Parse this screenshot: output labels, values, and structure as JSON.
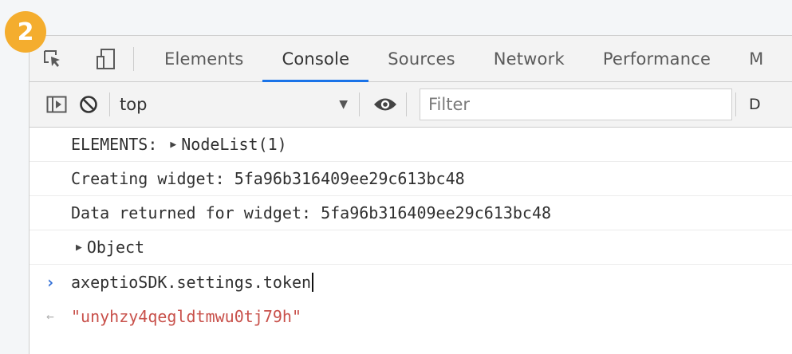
{
  "step": {
    "number": "2"
  },
  "devtools": {
    "tabs": [
      {
        "label": "Elements",
        "active": false
      },
      {
        "label": "Console",
        "active": true
      },
      {
        "label": "Sources",
        "active": false
      },
      {
        "label": "Network",
        "active": false
      },
      {
        "label": "Performance",
        "active": false
      },
      {
        "label": "M",
        "active": false
      }
    ],
    "toolbar": {
      "context": "top",
      "filter_placeholder": "Filter",
      "truncated_label": "D"
    },
    "console": {
      "lines": [
        {
          "prefix": "ELEMENTS: ",
          "expandable_label": "NodeList(1)"
        },
        {
          "text": "Creating widget: 5fa96b316409ee29c613bc48"
        },
        {
          "text": "Data returned for widget: 5fa96b316409ee29c613bc48"
        },
        {
          "expandable_label": "Object"
        }
      ],
      "input": {
        "text": "axeptioSDK.settings.token"
      },
      "result": {
        "text": "\"unyhzy4qegldtmwu0tj79h\""
      }
    }
  },
  "colors": {
    "badge": "#f4ad2e",
    "active_tab_underline": "#1a73e8",
    "prompt_arrow": "#2f6dd6",
    "result_string": "#c8504a"
  },
  "icons": [
    "inspect-element-icon",
    "device-toolbar-icon",
    "sidebar-toggle-icon",
    "clear-console-icon",
    "dropdown-arrow-icon",
    "eye-icon",
    "prompt-arrow-icon",
    "result-arrow-icon"
  ]
}
